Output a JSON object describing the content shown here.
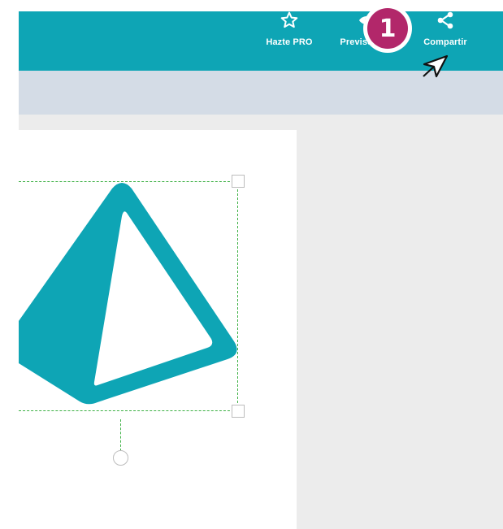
{
  "toolbar": {
    "items": [
      {
        "label": "Hazte PRO",
        "icon": "star-outline-icon"
      },
      {
        "label": "Previsualizar",
        "icon": "eye-icon"
      },
      {
        "label": "Compartir",
        "icon": "share-icon"
      }
    ]
  },
  "step_badge": {
    "number": "1",
    "color": "#b2276a"
  },
  "colors": {
    "accent": "#0ea5b5",
    "subbar": "#d4dce6",
    "workspace": "#ececec",
    "selection": "#3cb043",
    "shape": "#0ea5b5"
  }
}
